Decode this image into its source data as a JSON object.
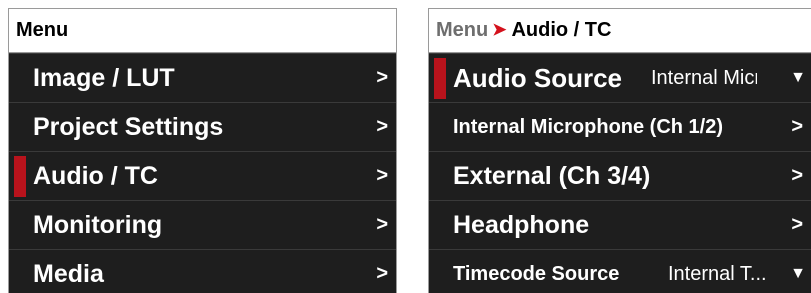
{
  "left_panel": {
    "header": "Menu",
    "items": [
      {
        "label": "Image / LUT",
        "chevron": ">"
      },
      {
        "label": "Project Settings",
        "chevron": ">"
      },
      {
        "label": "Audio / TC",
        "chevron": ">",
        "selected": true
      },
      {
        "label": "Monitoring",
        "chevron": ">"
      },
      {
        "label": "Media",
        "chevron": ">"
      }
    ]
  },
  "right_panel": {
    "breadcrumb": {
      "parent": "Menu",
      "separator": "➤",
      "current": "Audio / TC"
    },
    "items": [
      {
        "label": "Audio Source",
        "value": "Internal Micr",
        "dropdown": "▼",
        "selected": true
      },
      {
        "label": "Internal Microphone (Ch 1/2)",
        "chevron": ">"
      },
      {
        "label": "External (Ch 3/4)",
        "chevron": ">"
      },
      {
        "label": "Headphone",
        "chevron": ">"
      },
      {
        "label": "Timecode Source",
        "value": "Internal T...",
        "dropdown": "▼"
      }
    ]
  },
  "colors": {
    "panel_bg": "#1e1e1e",
    "header_bg": "#ffffff",
    "selection_accent": "#b8131c",
    "breadcrumb_arrow": "#d4111c",
    "breadcrumb_parent": "#6e6e6e"
  },
  "icons": {
    "chevron": "chevron-right-icon",
    "dropdown": "caret-down-icon",
    "breadcrumb_separator": "arrow-right-icon"
  }
}
